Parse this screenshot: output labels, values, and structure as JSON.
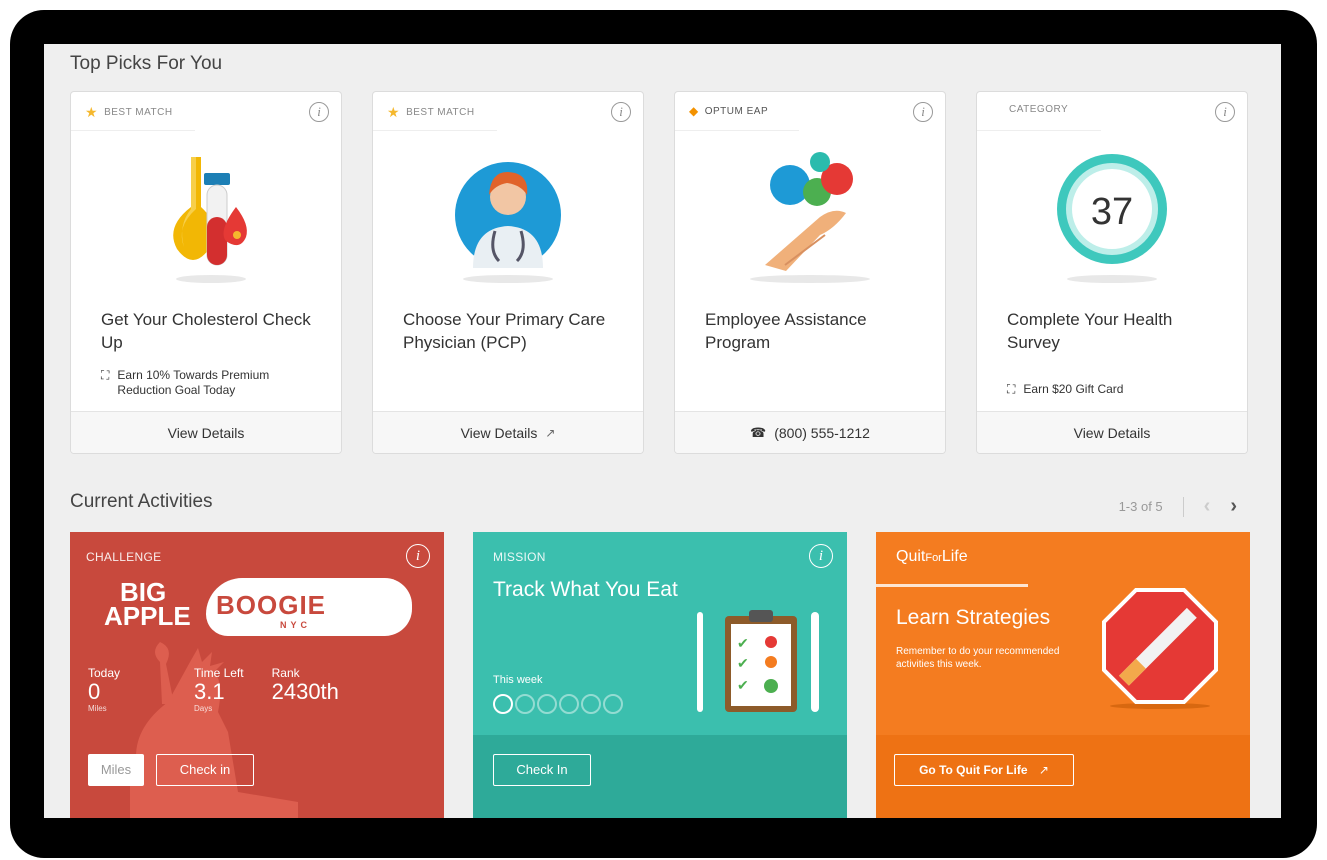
{
  "top_picks": {
    "title": "Top Picks For You",
    "cards": [
      {
        "tag": "BEST MATCH",
        "tag_icon": "star-icon",
        "title": "Get Your Cholesterol Check Up",
        "reward": "Earn 10% Towards Premium Reduction Goal Today",
        "footer": "View Details"
      },
      {
        "tag": "BEST MATCH",
        "tag_icon": "star-icon",
        "title": "Choose Your Primary Care Physician (PCP)",
        "reward": "",
        "footer": "View Details"
      },
      {
        "tag": "OPTUM EAP",
        "tag_icon": "optum-logo",
        "title": "Employee Assistance Program",
        "reward": "",
        "footer": "(800) 555-1212"
      },
      {
        "tag": "CATEGORY",
        "tag_icon": "",
        "title": "Complete Your Health Survey",
        "reward": "Earn $20 Gift Card",
        "footer": "View Details",
        "gauge_value": "37"
      }
    ]
  },
  "activities": {
    "title": "Current Activities",
    "pager": "1-3 of 5",
    "challenge": {
      "kind": "CHALLENGE",
      "logo_line1": "BIG",
      "logo_line2": "APPLE",
      "logo_boogie": "BOOGIE",
      "logo_nyc": "NYC",
      "stats": [
        {
          "label": "Today",
          "value": "0",
          "unit": "Miles"
        },
        {
          "label": "Time Left",
          "value": "3.1",
          "unit": "Days"
        },
        {
          "label": "Rank",
          "value": "2430th",
          "unit": ""
        }
      ],
      "miles_button": "Miles",
      "checkin_button": "Check in"
    },
    "mission": {
      "kind": "MISSION",
      "title": "Track What You Eat",
      "week_label": "This week",
      "days_total": 6,
      "days_done": 0,
      "checkin_button": "Check In"
    },
    "quit": {
      "brand": "Quit",
      "brand_for": "For",
      "brand_life": "Life",
      "title": "Learn Strategies",
      "text": "Remember to do your recommended activities this week.",
      "button": "Go To Quit For Life"
    }
  },
  "colors": {
    "challenge": "#c8493d",
    "mission": "#3bbfae",
    "mission_footer": "#2eaa99",
    "quit": "#f47c20",
    "quit_footer": "#ee7214"
  }
}
